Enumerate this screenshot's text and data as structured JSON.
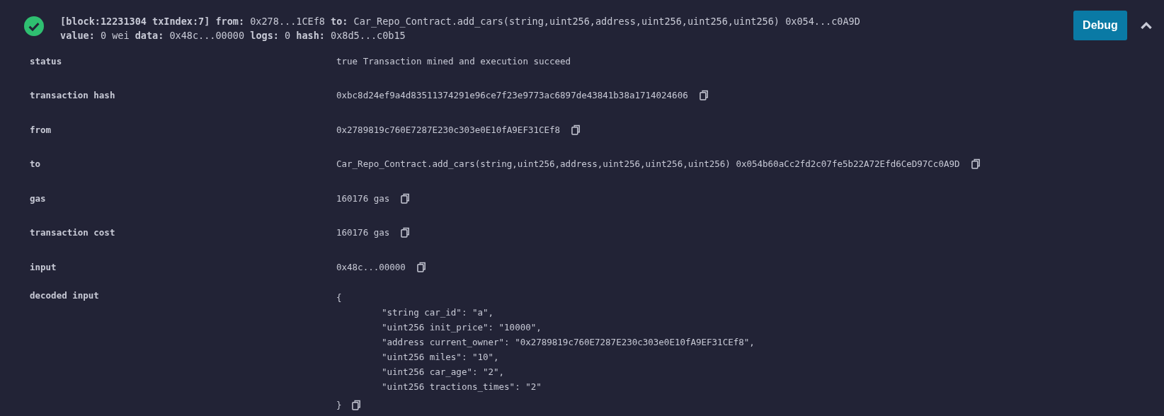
{
  "header": {
    "succeeded": true,
    "lines": [
      "**[block:12231304 txIndex:7]** **from:** 0x278...1CEf8 **to:** Car_Repo_Contract.add_cars(string,uint256,address,uint256,uint256,uint256) 0x054...c0A9D",
      "**value:** 0 wei **data:** 0x48c...00000 **logs:** 0 **hash:** 0x8d5...c0b15"
    ],
    "debug_button": "Debug",
    "expanded": true
  },
  "rows": [
    {
      "label": "status",
      "value": "true Transaction mined and execution succeed",
      "copy": false
    },
    {
      "label": "transaction hash",
      "value": "0xbc8d24ef9a4d83511374291e96ce7f23e9773ac6897de43841b38a1714024606",
      "copy": true
    },
    {
      "label": "from",
      "value": "0x2789819c760E7287E230c303e0E10fA9EF31CEf8",
      "copy": true
    },
    {
      "label": "to",
      "value": "Car_Repo_Contract.add_cars(string,uint256,address,uint256,uint256,uint256) 0x054b60aCc2fd2c07fe5b22A72Efd6CeD97Cc0A9D",
      "copy": true
    },
    {
      "label": "gas",
      "value": "160176 gas",
      "copy": true
    },
    {
      "label": "transaction cost",
      "value": "160176 gas",
      "copy": true
    },
    {
      "label": "input",
      "value": "0x48c...00000",
      "copy": true
    }
  ],
  "decoded_input": {
    "label": "decoded input",
    "open": "{",
    "entries": [
      "\"string car_id\": \"a\",",
      "\"uint256 init_price\": \"10000\",",
      "\"address current_owner\": \"0x2789819c760E7287E230c303e0E10fA9EF31CEf8\",",
      "\"uint256 miles\": \"10\",",
      "\"uint256 car_age\": \"2\",",
      "\"uint256 tractions_times\": \"2\""
    ],
    "close": "}",
    "copy": true
  }
}
